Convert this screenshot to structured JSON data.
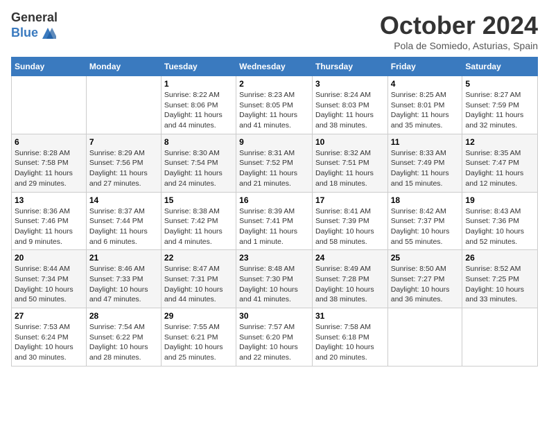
{
  "logo": {
    "general": "General",
    "blue": "Blue"
  },
  "title": "October 2024",
  "location": "Pola de Somiedo, Asturias, Spain",
  "weekdays": [
    "Sunday",
    "Monday",
    "Tuesday",
    "Wednesday",
    "Thursday",
    "Friday",
    "Saturday"
  ],
  "weeks": [
    [
      {
        "day": "",
        "sunrise": "",
        "sunset": "",
        "daylight": ""
      },
      {
        "day": "",
        "sunrise": "",
        "sunset": "",
        "daylight": ""
      },
      {
        "day": "1",
        "sunrise": "Sunrise: 8:22 AM",
        "sunset": "Sunset: 8:06 PM",
        "daylight": "Daylight: 11 hours and 44 minutes."
      },
      {
        "day": "2",
        "sunrise": "Sunrise: 8:23 AM",
        "sunset": "Sunset: 8:05 PM",
        "daylight": "Daylight: 11 hours and 41 minutes."
      },
      {
        "day": "3",
        "sunrise": "Sunrise: 8:24 AM",
        "sunset": "Sunset: 8:03 PM",
        "daylight": "Daylight: 11 hours and 38 minutes."
      },
      {
        "day": "4",
        "sunrise": "Sunrise: 8:25 AM",
        "sunset": "Sunset: 8:01 PM",
        "daylight": "Daylight: 11 hours and 35 minutes."
      },
      {
        "day": "5",
        "sunrise": "Sunrise: 8:27 AM",
        "sunset": "Sunset: 7:59 PM",
        "daylight": "Daylight: 11 hours and 32 minutes."
      }
    ],
    [
      {
        "day": "6",
        "sunrise": "Sunrise: 8:28 AM",
        "sunset": "Sunset: 7:58 PM",
        "daylight": "Daylight: 11 hours and 29 minutes."
      },
      {
        "day": "7",
        "sunrise": "Sunrise: 8:29 AM",
        "sunset": "Sunset: 7:56 PM",
        "daylight": "Daylight: 11 hours and 27 minutes."
      },
      {
        "day": "8",
        "sunrise": "Sunrise: 8:30 AM",
        "sunset": "Sunset: 7:54 PM",
        "daylight": "Daylight: 11 hours and 24 minutes."
      },
      {
        "day": "9",
        "sunrise": "Sunrise: 8:31 AM",
        "sunset": "Sunset: 7:52 PM",
        "daylight": "Daylight: 11 hours and 21 minutes."
      },
      {
        "day": "10",
        "sunrise": "Sunrise: 8:32 AM",
        "sunset": "Sunset: 7:51 PM",
        "daylight": "Daylight: 11 hours and 18 minutes."
      },
      {
        "day": "11",
        "sunrise": "Sunrise: 8:33 AM",
        "sunset": "Sunset: 7:49 PM",
        "daylight": "Daylight: 11 hours and 15 minutes."
      },
      {
        "day": "12",
        "sunrise": "Sunrise: 8:35 AM",
        "sunset": "Sunset: 7:47 PM",
        "daylight": "Daylight: 11 hours and 12 minutes."
      }
    ],
    [
      {
        "day": "13",
        "sunrise": "Sunrise: 8:36 AM",
        "sunset": "Sunset: 7:46 PM",
        "daylight": "Daylight: 11 hours and 9 minutes."
      },
      {
        "day": "14",
        "sunrise": "Sunrise: 8:37 AM",
        "sunset": "Sunset: 7:44 PM",
        "daylight": "Daylight: 11 hours and 6 minutes."
      },
      {
        "day": "15",
        "sunrise": "Sunrise: 8:38 AM",
        "sunset": "Sunset: 7:42 PM",
        "daylight": "Daylight: 11 hours and 4 minutes."
      },
      {
        "day": "16",
        "sunrise": "Sunrise: 8:39 AM",
        "sunset": "Sunset: 7:41 PM",
        "daylight": "Daylight: 11 hours and 1 minute."
      },
      {
        "day": "17",
        "sunrise": "Sunrise: 8:41 AM",
        "sunset": "Sunset: 7:39 PM",
        "daylight": "Daylight: 10 hours and 58 minutes."
      },
      {
        "day": "18",
        "sunrise": "Sunrise: 8:42 AM",
        "sunset": "Sunset: 7:37 PM",
        "daylight": "Daylight: 10 hours and 55 minutes."
      },
      {
        "day": "19",
        "sunrise": "Sunrise: 8:43 AM",
        "sunset": "Sunset: 7:36 PM",
        "daylight": "Daylight: 10 hours and 52 minutes."
      }
    ],
    [
      {
        "day": "20",
        "sunrise": "Sunrise: 8:44 AM",
        "sunset": "Sunset: 7:34 PM",
        "daylight": "Daylight: 10 hours and 50 minutes."
      },
      {
        "day": "21",
        "sunrise": "Sunrise: 8:46 AM",
        "sunset": "Sunset: 7:33 PM",
        "daylight": "Daylight: 10 hours and 47 minutes."
      },
      {
        "day": "22",
        "sunrise": "Sunrise: 8:47 AM",
        "sunset": "Sunset: 7:31 PM",
        "daylight": "Daylight: 10 hours and 44 minutes."
      },
      {
        "day": "23",
        "sunrise": "Sunrise: 8:48 AM",
        "sunset": "Sunset: 7:30 PM",
        "daylight": "Daylight: 10 hours and 41 minutes."
      },
      {
        "day": "24",
        "sunrise": "Sunrise: 8:49 AM",
        "sunset": "Sunset: 7:28 PM",
        "daylight": "Daylight: 10 hours and 38 minutes."
      },
      {
        "day": "25",
        "sunrise": "Sunrise: 8:50 AM",
        "sunset": "Sunset: 7:27 PM",
        "daylight": "Daylight: 10 hours and 36 minutes."
      },
      {
        "day": "26",
        "sunrise": "Sunrise: 8:52 AM",
        "sunset": "Sunset: 7:25 PM",
        "daylight": "Daylight: 10 hours and 33 minutes."
      }
    ],
    [
      {
        "day": "27",
        "sunrise": "Sunrise: 7:53 AM",
        "sunset": "Sunset: 6:24 PM",
        "daylight": "Daylight: 10 hours and 30 minutes."
      },
      {
        "day": "28",
        "sunrise": "Sunrise: 7:54 AM",
        "sunset": "Sunset: 6:22 PM",
        "daylight": "Daylight: 10 hours and 28 minutes."
      },
      {
        "day": "29",
        "sunrise": "Sunrise: 7:55 AM",
        "sunset": "Sunset: 6:21 PM",
        "daylight": "Daylight: 10 hours and 25 minutes."
      },
      {
        "day": "30",
        "sunrise": "Sunrise: 7:57 AM",
        "sunset": "Sunset: 6:20 PM",
        "daylight": "Daylight: 10 hours and 22 minutes."
      },
      {
        "day": "31",
        "sunrise": "Sunrise: 7:58 AM",
        "sunset": "Sunset: 6:18 PM",
        "daylight": "Daylight: 10 hours and 20 minutes."
      },
      {
        "day": "",
        "sunrise": "",
        "sunset": "",
        "daylight": ""
      },
      {
        "day": "",
        "sunrise": "",
        "sunset": "",
        "daylight": ""
      }
    ]
  ]
}
